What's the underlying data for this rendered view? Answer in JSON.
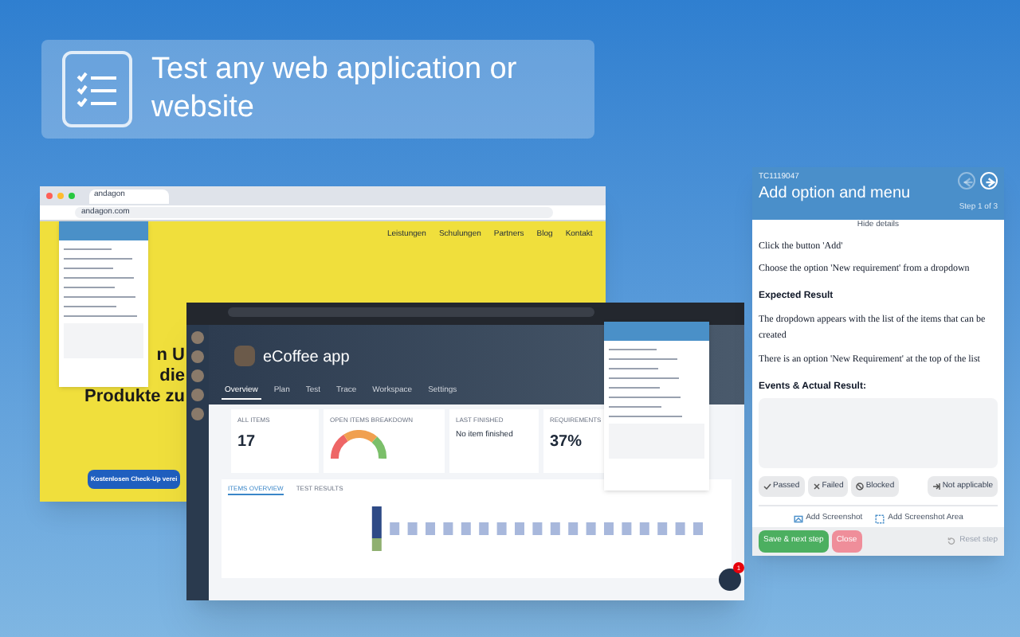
{
  "banner": {
    "title": "Test any web application or website"
  },
  "back_browser": {
    "tab_title": "andagon",
    "url": "andagon.com",
    "nav_links": [
      "Leistungen",
      "Schulungen",
      "Partners",
      "Blog",
      "Kontakt"
    ],
    "headline_lines": [
      "n U",
      "die",
      "Produkte zu"
    ],
    "cta": "Kostenlosen Check-Up verei"
  },
  "front_browser": {
    "app_title": "eCoffee app",
    "tabs": [
      {
        "label": "Overview",
        "selected": true
      },
      {
        "label": "Plan",
        "selected": false
      },
      {
        "label": "Test",
        "selected": false
      },
      {
        "label": "Trace",
        "selected": false
      },
      {
        "label": "Workspace",
        "selected": false
      },
      {
        "label": "Settings",
        "selected": false
      }
    ],
    "cards": [
      {
        "label": "ALL ITEMS",
        "value": "17"
      },
      {
        "label": "OPEN ITEMS BREAKDOWN"
      },
      {
        "label": "LAST FINISHED",
        "value": "No item finished"
      },
      {
        "label": "REQUIREMENTS",
        "value": "37%"
      }
    ],
    "chart_tabs": [
      {
        "label": "ITEMS OVERVIEW",
        "selected": true
      },
      {
        "label": "TEST RESULTS",
        "selected": false
      }
    ],
    "notification_count": "1"
  },
  "test_panel": {
    "test_id": "TC1119047",
    "title": "Add option and menu",
    "step": "Step 1 of 3",
    "prev_enabled": false,
    "next_enabled": true,
    "hide_details": "Hide details",
    "steps": [
      "Click the button 'Add'",
      "Choose the option 'New requirement' from a dropdown"
    ],
    "expected_heading": "Expected Result",
    "expected": [
      "The dropdown appears with the list of the items that can be created",
      "There is an option 'New Requirement' at the top of the list"
    ],
    "actual_heading": "Events & Actual Result:",
    "results": [
      {
        "kind": "passed",
        "label": "Passed"
      },
      {
        "kind": "failed",
        "label": "Failed"
      },
      {
        "kind": "blocked",
        "label": "Blocked"
      },
      {
        "kind": "na",
        "label": "Not applicable"
      }
    ],
    "links": [
      {
        "kind": "screenshot",
        "label": "Add Screenshot"
      },
      {
        "kind": "area",
        "label": "Add Screenshot Area"
      }
    ],
    "save": "Save & next step",
    "close": "Close",
    "reset": "Reset step"
  }
}
